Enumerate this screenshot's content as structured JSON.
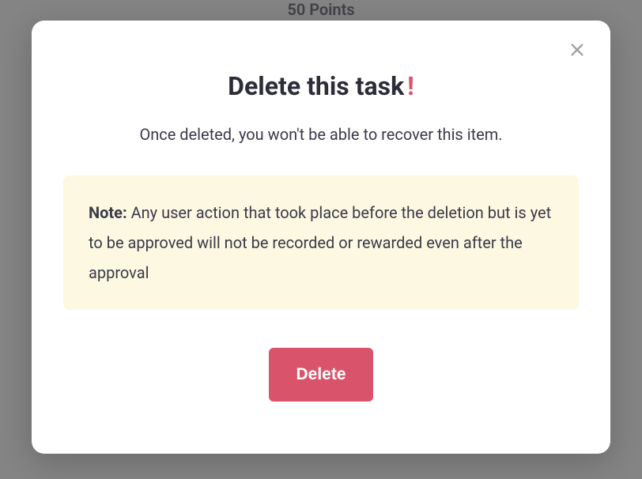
{
  "backdrop": {
    "points_text": "50 Points"
  },
  "modal": {
    "title": "Delete this task",
    "title_punct": "!",
    "subtitle": "Once deleted, you won't be able to recover this item.",
    "note_label": "Note:",
    "note_body": " Any user action that took place before the deletion but is yet to be approved will not be recorded or rewarded even after the approval",
    "delete_label": "Delete"
  }
}
